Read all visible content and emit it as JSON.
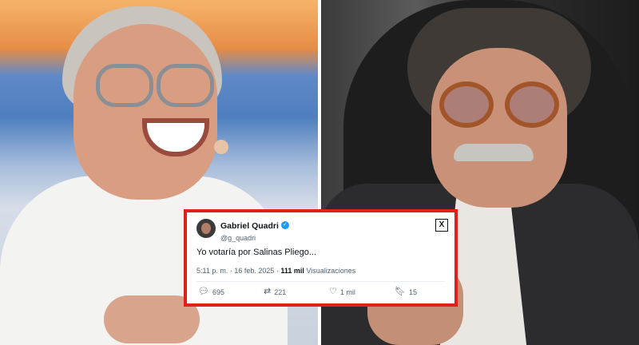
{
  "tweet": {
    "display_name": "Gabriel Quadri",
    "handle": "@g_quadri",
    "text": "Yo votaría por Salinas Pliego...",
    "time": "5:11 p. m. · 16 feb. 2025 · ",
    "views_count": "111 mil",
    "views_label": " Visualizaciones",
    "replies": "695",
    "retweets": "221",
    "likes": "1 mil",
    "bookmarks": "15",
    "icons": {
      "verified": "verified-icon",
      "platform": "x-logo-icon",
      "reply": "reply-icon",
      "retweet": "retweet-icon",
      "like": "heart-icon",
      "bookmark": "bookmark-icon"
    },
    "accent_color": "#e0201a"
  }
}
